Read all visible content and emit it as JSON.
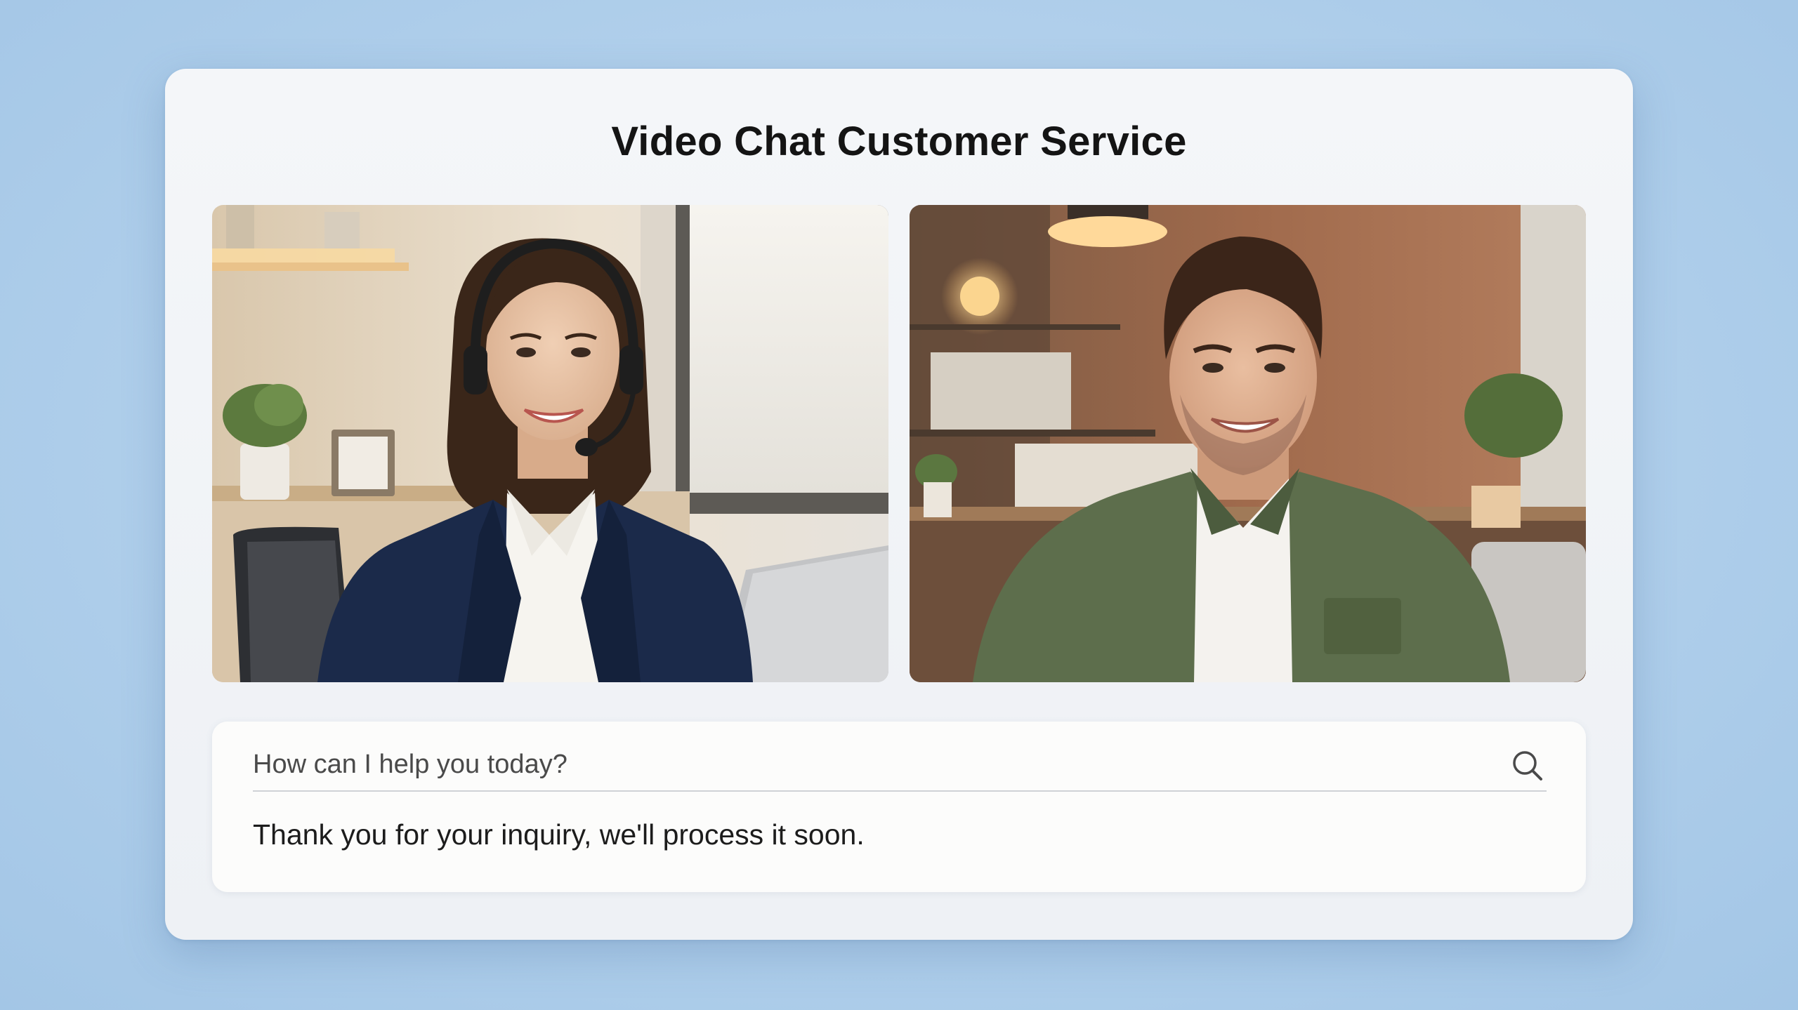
{
  "app": {
    "title": "Video Chat Customer Service"
  },
  "videos": {
    "agent": {
      "name": "agent-video-feed"
    },
    "customer": {
      "name": "customer-video-feed"
    }
  },
  "chat": {
    "input_placeholder": "How can I help you today?",
    "input_value": "",
    "search_icon": "search-icon",
    "reply_text": "Thank you for your inquiry, we'll process it soon."
  },
  "colors": {
    "background": "#b0cfeb",
    "card": "#f2f4f7",
    "title_text": "#141414",
    "agent_blazer": "#1b2a4a",
    "customer_shirt": "#5d6e4c"
  }
}
